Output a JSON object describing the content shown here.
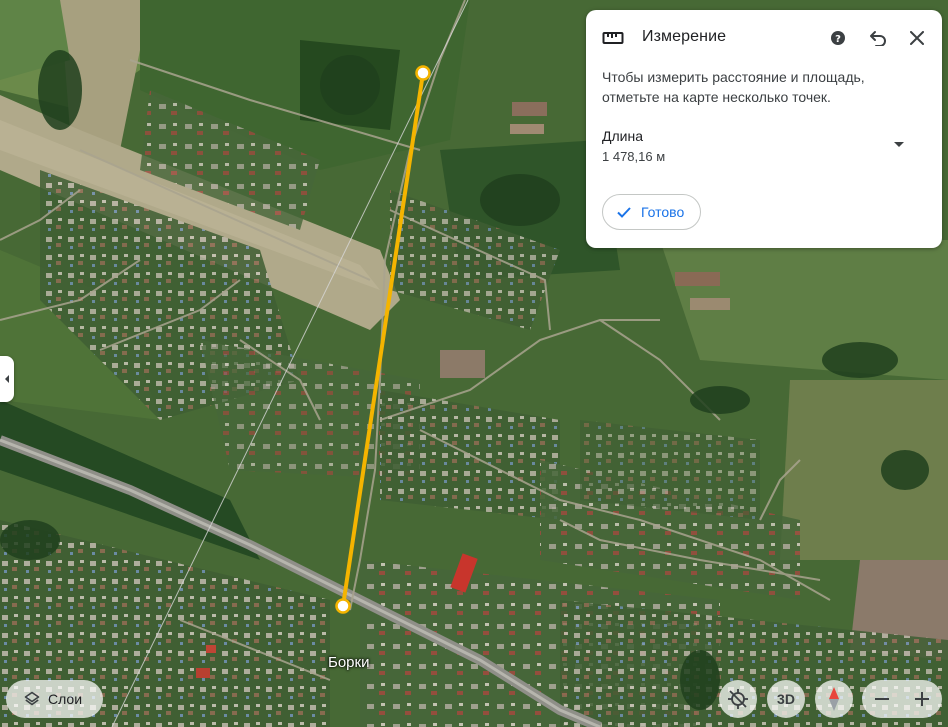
{
  "map": {
    "place_label": "Борки",
    "measure_line_color": "#f4b400"
  },
  "panel": {
    "title": "Измерение",
    "description": "Чтобы измерить расстояние и площадь, отметьте на карте несколько точек.",
    "length_label": "Длина",
    "length_value": "1 478,16 м",
    "done_label": "Готово",
    "icons": {
      "title": "ruler-icon",
      "help": "help-icon",
      "undo": "undo-icon",
      "close": "close-icon",
      "dropdown": "chevron-down-icon",
      "done": "check-icon"
    },
    "accent_color": "#1a73e8"
  },
  "controls": {
    "layers_label": "Слои",
    "three_d_label": "3D",
    "icons": {
      "layers": "layers-icon",
      "locate": "location-off-icon",
      "compass": "compass-icon",
      "zoom_out": "minus-icon",
      "zoom_in": "plus-icon",
      "side_tab": "chevron-left-icon"
    }
  }
}
